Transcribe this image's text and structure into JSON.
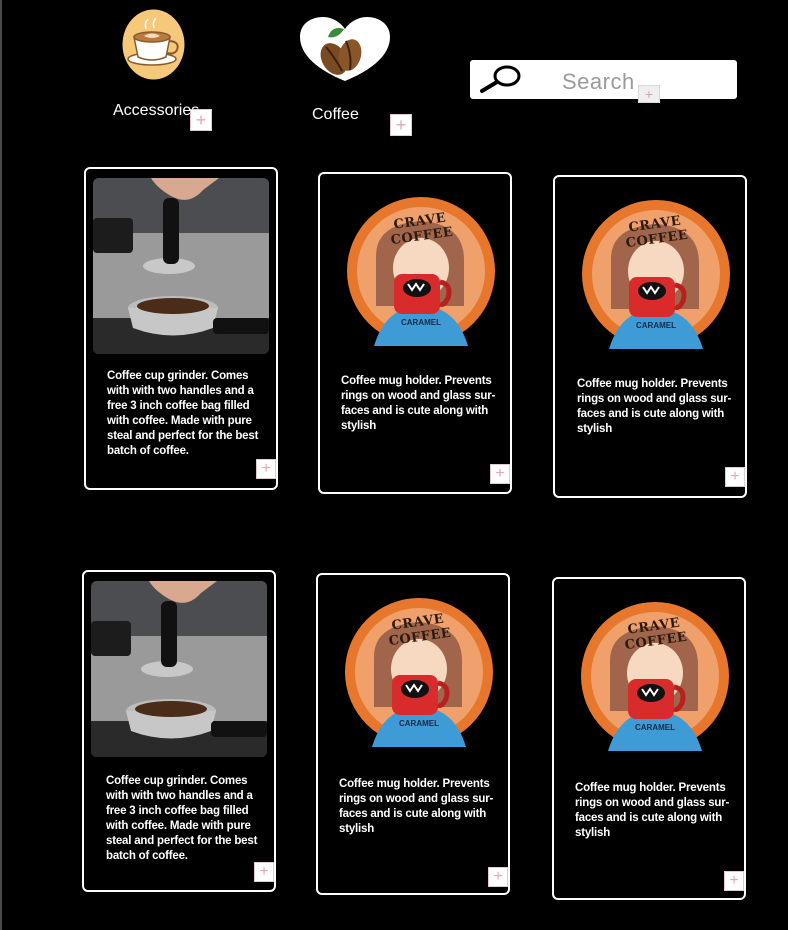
{
  "categories": [
    {
      "label": "Accessories",
      "icon": "coffee-cup-icon"
    },
    {
      "label": "Coffee",
      "icon": "coffee-beans-icon"
    }
  ],
  "search": {
    "placeholder": "Search",
    "icon": "magnifier-icon"
  },
  "add_symbol": "+",
  "products": [
    {
      "description": "Coffee cup grinder. Comes with with two handles and a free 3 inch coffee bag filled with coffee. Made with pure steal and perfect for the best batch of coffee.",
      "image": "coffee-tamper-photo"
    },
    {
      "description": "Coffee mug holder. Prevents rings on wood and glass sur-faces and is cute along with stylish",
      "image": "crave-coffee-logo",
      "logo_top": "CRAVE COFFEE",
      "logo_bottom": "CARAMEL"
    },
    {
      "description": "Coffee mug holder. Prevents rings on wood and glass sur-faces and is cute along with stylish",
      "image": "crave-coffee-logo",
      "logo_top": "CRAVE COFFEE",
      "logo_bottom": "CARAMEL"
    },
    {
      "description": "Coffee cup grinder. Comes with with two handles and a free 3 inch coffee bag filled with coffee. Made with pure steal and perfect for the best batch of coffee.",
      "image": "coffee-tamper-photo"
    },
    {
      "description": "Coffee mug holder. Prevents rings on wood and glass sur-faces and is cute along with stylish",
      "image": "crave-coffee-logo",
      "logo_top": "CRAVE COFFEE",
      "logo_bottom": "CARAMEL"
    },
    {
      "description": "Coffee mug holder. Prevents rings on wood and glass sur-faces and is cute along with stylish",
      "image": "crave-coffee-logo",
      "logo_top": "CRAVE COFFEE",
      "logo_bottom": "CARAMEL"
    }
  ],
  "colors": {
    "background": "#000000",
    "card_border": "#ffffff",
    "logo_orange": "#e8772e",
    "logo_red": "#d92b2b",
    "plus_pink": "#e7a6b3"
  }
}
